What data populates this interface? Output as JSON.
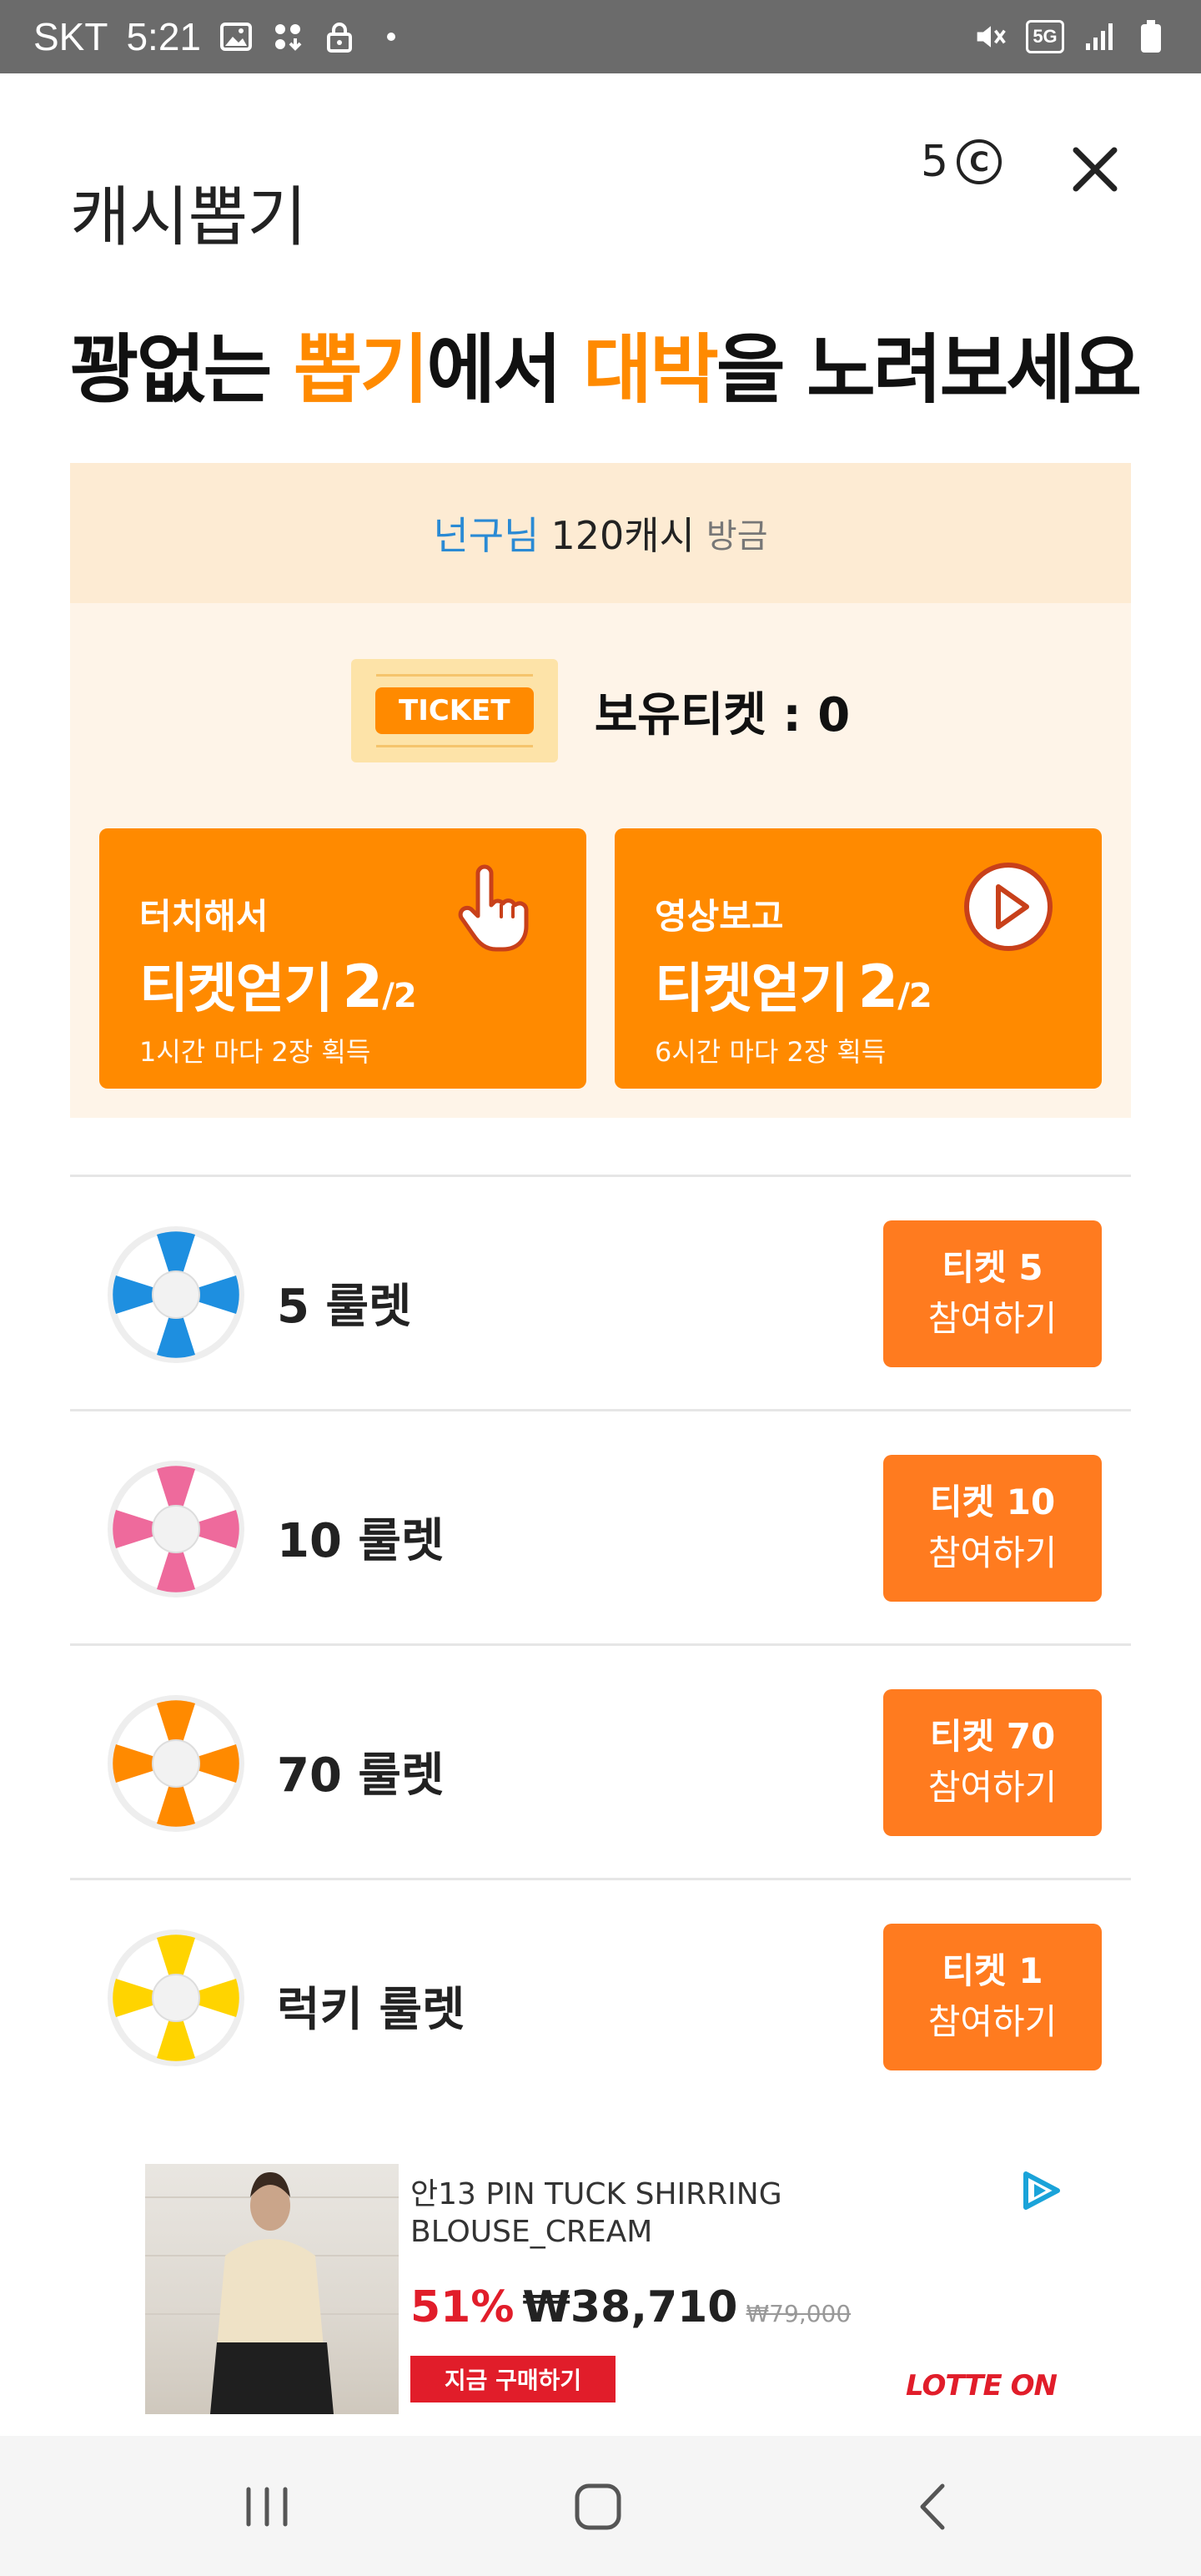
{
  "status_bar": {
    "carrier": "SKT",
    "time": "5:21",
    "network": "5G"
  },
  "header": {
    "title": "캐시뽑기",
    "coin_count": "5",
    "coin_symbol": "C"
  },
  "headline": {
    "part1": "꽝없는 ",
    "hl1": "뽑기",
    "part2": "에서 ",
    "hl2": "대박",
    "part3": "을 노려보세요",
    "accent_color": "#ff8a00"
  },
  "user_bar": {
    "name": "넌구님",
    "cash": "120캐시",
    "suffix": "방금"
  },
  "ticket": {
    "tag": "TICKET",
    "count_label": "보유티켓 : 0"
  },
  "earn_cards": [
    {
      "sub": "터치해서",
      "main": "티켓얻기",
      "count": "2",
      "total": "/2",
      "note": "1시간 마다 2장 획득",
      "icon": "hand-pointer-icon"
    },
    {
      "sub": "영상보고",
      "main": "티켓얻기",
      "count": "2",
      "total": "/2",
      "note": "6시간 마다 2장 획득",
      "icon": "play-circle-icon"
    }
  ],
  "roulettes": [
    {
      "label": "5 룰렛",
      "button_line1": "티켓 5",
      "button_line2": "참여하기",
      "color": "#1e8fe0"
    },
    {
      "label": "10 룰렛",
      "button_line1": "티켓 10",
      "button_line2": "참여하기",
      "color": "#ee6a9c"
    },
    {
      "label": "70 룰렛",
      "button_line1": "티켓 70",
      "button_line2": "참여하기",
      "color": "#ff8a00"
    },
    {
      "label": "럭키 룰렛",
      "button_line1": "티켓 1",
      "button_line2": "참여하기",
      "color": "#ffd400"
    }
  ],
  "ad": {
    "title": "안13 PIN TUCK SHIRRING BLOUSE_CREAM",
    "discount": "51%",
    "price": "₩38,710",
    "old_price": "₩79,000",
    "buy_label": "지금 구매하기",
    "brand": "LOTTE ON"
  }
}
